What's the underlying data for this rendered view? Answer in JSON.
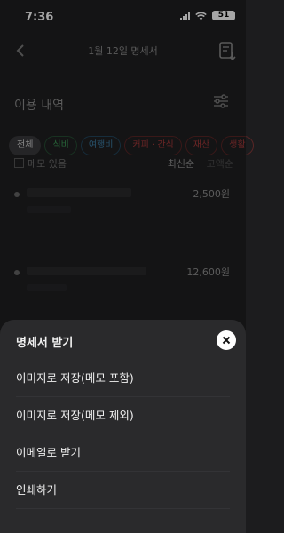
{
  "status_bar": {
    "time": "7:36",
    "battery": "51"
  },
  "header": {
    "title": "1월 12일 명세서"
  },
  "section": {
    "title": "이용 내역"
  },
  "chips": [
    "전체",
    "식비",
    "여행비",
    "커피 · 간식",
    "재산",
    "생활"
  ],
  "memo": {
    "label": "메모 있음"
  },
  "sort": {
    "latest": "최신순",
    "highest": "고액순"
  },
  "transactions": [
    {
      "amount": "2,500원"
    },
    {
      "amount": "12,600원"
    }
  ],
  "sheet": {
    "title": "명세서 받기",
    "options": [
      "이미지로 저장(메모 포함)",
      "이미지로 저장(메모 제외)",
      "이메일로 받기",
      "인쇄하기"
    ]
  }
}
